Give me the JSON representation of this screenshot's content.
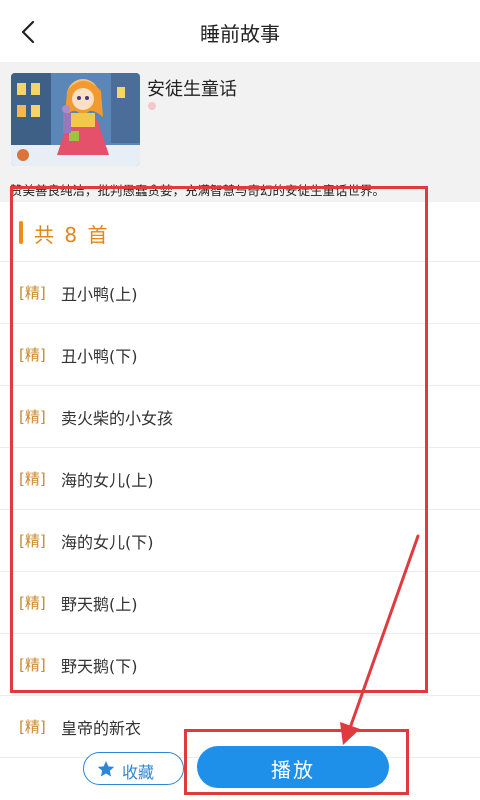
{
  "header": {
    "title": "睡前故事"
  },
  "album": {
    "name": "安徒生童话",
    "description": "赞美善良纯洁，批判愚蠢贪婪，充满智慧与奇幻的安徒生童话世界。"
  },
  "list": {
    "count_label": "共 8 首",
    "tag": "[精]",
    "items": [
      {
        "title": "丑小鸭(上)"
      },
      {
        "title": "丑小鸭(下)"
      },
      {
        "title": "卖火柴的小女孩"
      },
      {
        "title": "海的女儿(上)"
      },
      {
        "title": "海的女儿(下)"
      },
      {
        "title": "野天鹅(上)"
      },
      {
        "title": "野天鹅(下)"
      },
      {
        "title": "皇帝的新衣"
      }
    ]
  },
  "actions": {
    "favorite_label": "收藏",
    "play_label": "播放"
  },
  "colors": {
    "accent_orange": "#e6851a",
    "primary_blue": "#1e90e9",
    "annotation_red": "#e03a3e"
  },
  "icons": {
    "back": "chevron-left-icon",
    "favorite": "star-icon"
  }
}
